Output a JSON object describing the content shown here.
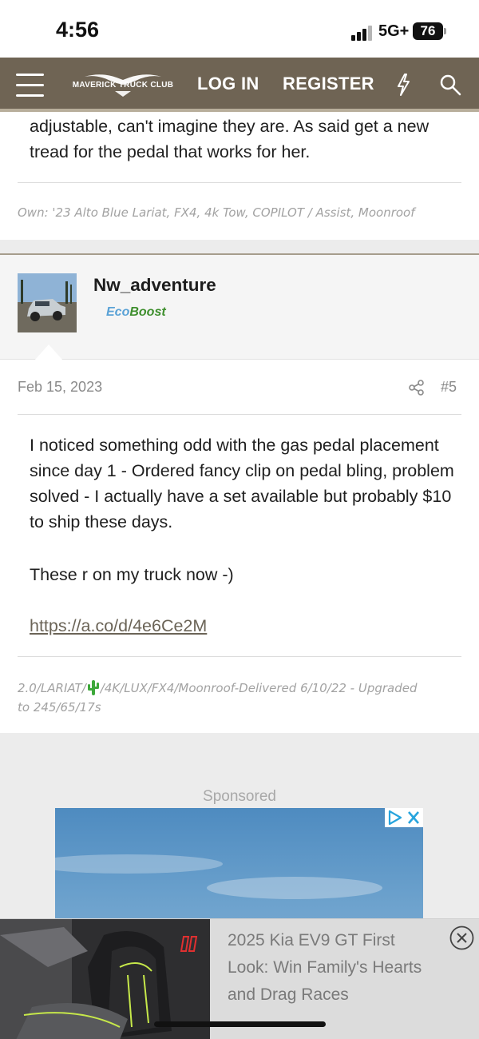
{
  "status_bar": {
    "time": "4:56",
    "network": "5G+",
    "battery": "76"
  },
  "navbar": {
    "logo_text": "MAVERICK TRUCK CLUB",
    "login_label": "LOG IN",
    "register_label": "REGISTER",
    "icons": [
      "menu-icon",
      "bolt-icon",
      "search-icon"
    ],
    "background_color": "#6f6454"
  },
  "post_prev": {
    "body_end": "adjustable, can't imagine they are. As said get a new tread for the pedal that works for her.",
    "signature": "Own: '23 Alto Blue Lariat, FX4, 4k Tow, COPILOT / Assist, Moonroof"
  },
  "post": {
    "username": "Nw_adventure",
    "badge_eco": "Eco",
    "badge_boost": "Boost",
    "date": "Feb 15, 2023",
    "number": "#5",
    "body_paragraph_1": "I noticed something odd with the gas pedal placement since day 1 - Ordered fancy clip on pedal bling, problem solved - I actually have a set available but probably $10 to ship these days.",
    "body_paragraph_2": "These r on my truck now -)",
    "link": "https://a.co/d/4e6Ce2M",
    "signature_part_1": "2.0/LARIAT/",
    "signature_part_2": "/4K/LUX/FX4/Moonroof-Delivered 6/10/22 - Upgraded to 245/65/17s"
  },
  "sponsored": {
    "label": "Sponsored"
  },
  "bottom_ad": {
    "title": "2025 Kia EV9 GT First Look: Win Family's Hearts and Drag Races"
  }
}
